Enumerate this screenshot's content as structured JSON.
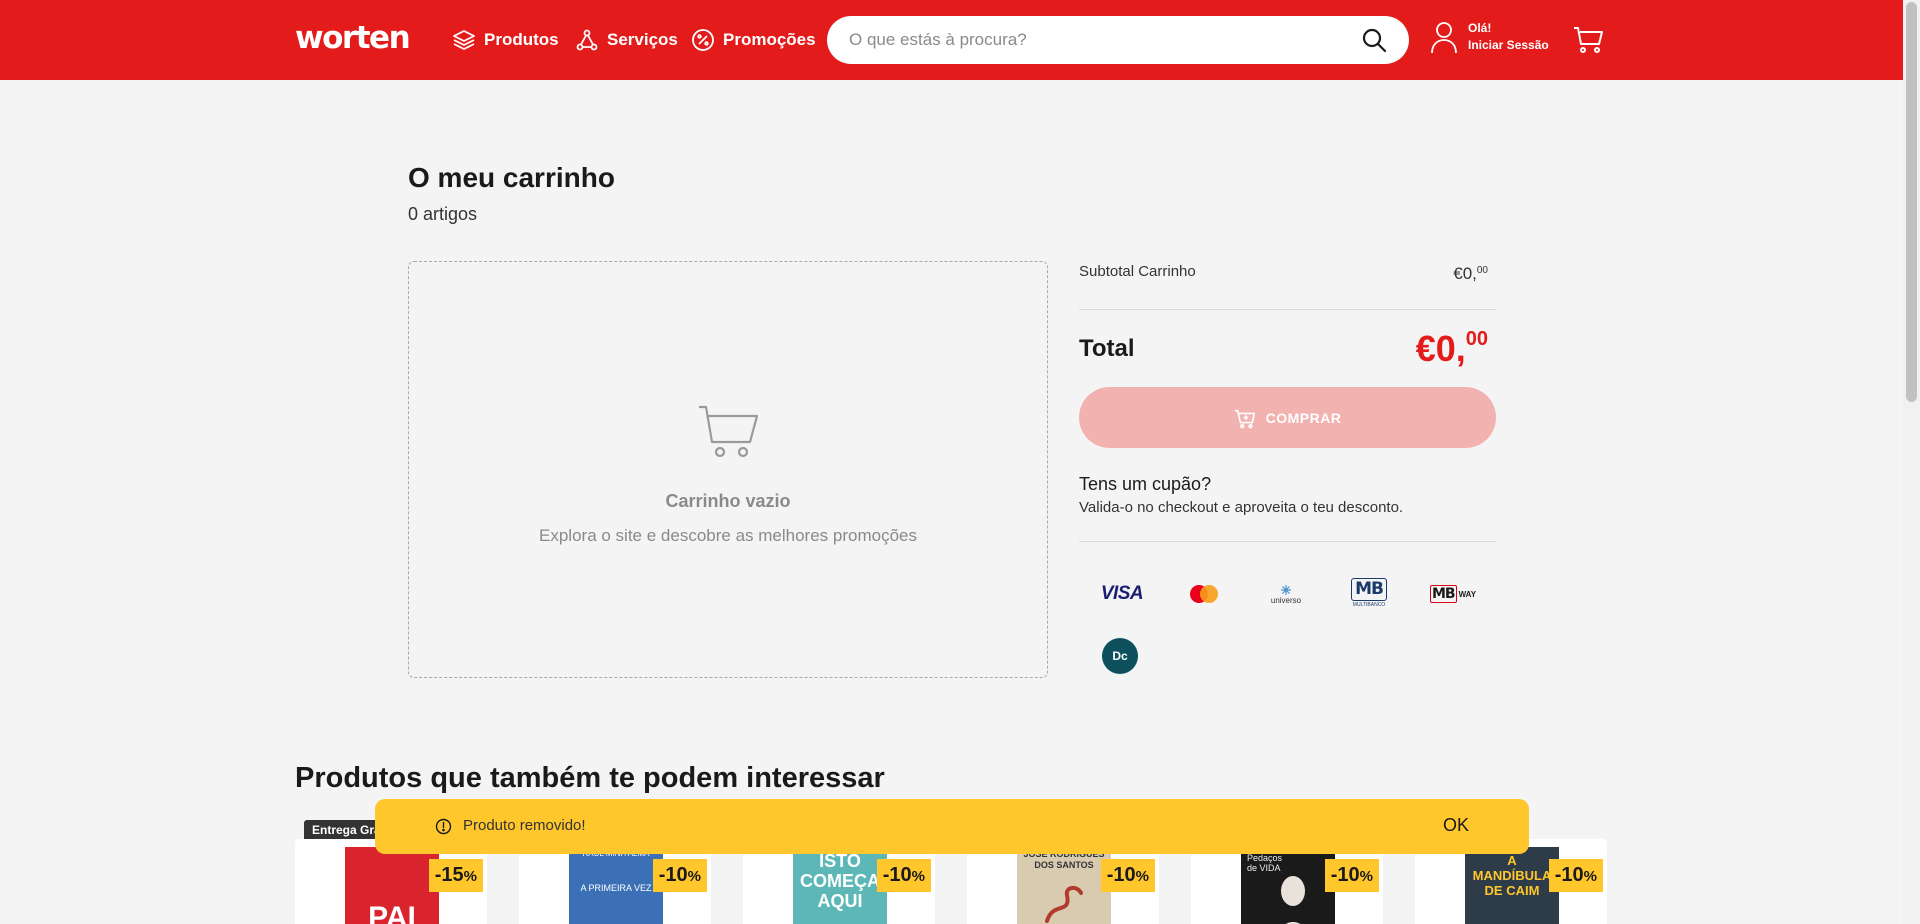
{
  "header": {
    "logo_text": "worten",
    "nav": [
      {
        "label": "Produtos",
        "icon": "layers-icon"
      },
      {
        "label": "Serviços",
        "icon": "services-icon"
      },
      {
        "label": "Promoções",
        "icon": "percent-badge-icon"
      }
    ],
    "search_placeholder": "O que estás à procura?",
    "account_greeting": "Olá!",
    "account_action": "Iniciar Sessão"
  },
  "cart": {
    "title": "O meu carrinho",
    "item_count": "0 artigos",
    "empty_title": "Carrinho vazio",
    "empty_subtitle": "Explora o site e descobre as melhores promoções"
  },
  "summary": {
    "subtotal_label": "Subtotal Carrinho",
    "subtotal_main": "€0,",
    "subtotal_cents": "00",
    "total_label": "Total",
    "total_main": "€0,",
    "total_cents": "00",
    "buy_label": "COMPRAR",
    "coupon_title": "Tens um cupão?",
    "coupon_subtitle": "Valida-o no checkout e aproveita o teu desconto."
  },
  "payment_methods": [
    "visa-logo",
    "mastercard-logo",
    "universo-logo",
    "multibanco-logo",
    "mbway-logo",
    "dc-logo"
  ],
  "payment_text": {
    "visa": "VISA",
    "universo": "universo",
    "mb": "MB",
    "mb_sub": "MULTIBANCO",
    "mbway_mb": "MB",
    "mbway_way": "WAY",
    "dc": "Dc"
  },
  "recommendations": {
    "title": "Produtos que também te podem interessar",
    "shipping_badge": "Entrega Grá",
    "products": [
      {
        "discount": "-15",
        "pct": "%",
        "book_text": "PAI",
        "book_top": "",
        "cover": "#d9232d"
      },
      {
        "discount": "-10",
        "pct": "%",
        "book_text": "A PRIMEIRA VEZ",
        "book_top": "RAUL MINH'ALMA",
        "cover": "#3b6fb6"
      },
      {
        "discount": "-10",
        "pct": "%",
        "book_text": "ISTO COMEÇA AQUI",
        "book_top": "",
        "cover": "#5eb7b7"
      },
      {
        "discount": "-10",
        "pct": "%",
        "book_text": "",
        "book_top": "JOSÉ RODRIGUES DOS SANTOS",
        "cover": "#d8cbb0"
      },
      {
        "discount": "-10",
        "pct": "%",
        "book_text": "",
        "book_top": "Pedaços de VIDA",
        "cover": "#1a1a1a"
      },
      {
        "discount": "-10",
        "pct": "%",
        "book_text": "A MANDÍBULA DE CAIM",
        "book_top": "",
        "cover": "#2e3b48"
      }
    ]
  },
  "toast": {
    "message": "Produto removido!",
    "ok_label": "OK",
    "icon": "alert-circle-icon"
  },
  "colors": {
    "brand_red": "#e31b1b",
    "disabled_button": "#f2b2b0",
    "promo_yellow": "#ffc72c",
    "page_background": "#f4f4f4"
  }
}
